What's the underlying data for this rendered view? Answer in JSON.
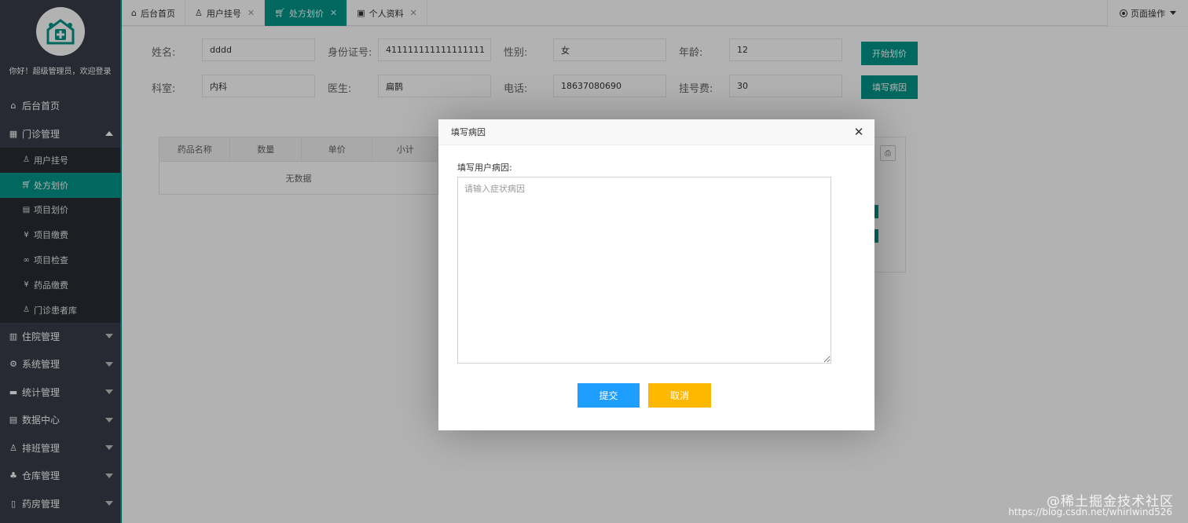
{
  "sidebar": {
    "welcome": "你好！超级管理员，欢迎登录",
    "home": "后台首页",
    "outpatient": "门诊管理",
    "sub_items": [
      {
        "label": "用户挂号",
        "icon": "user-icon"
      },
      {
        "label": "处方划价",
        "icon": "cart-icon"
      },
      {
        "label": "项目划价",
        "icon": "doc-icon"
      },
      {
        "label": "项目缴费",
        "icon": "yen-icon"
      },
      {
        "label": "项目检查",
        "icon": "link-icon"
      },
      {
        "label": "药品缴费",
        "icon": "yen-icon"
      },
      {
        "label": "门诊患者库",
        "icon": "person-icon"
      }
    ],
    "groups": [
      {
        "label": "住院管理",
        "icon": "building-icon"
      },
      {
        "label": "系统管理",
        "icon": "gear-icon"
      },
      {
        "label": "统计管理",
        "icon": "chat-icon"
      },
      {
        "label": "数据中心",
        "icon": "file-icon"
      },
      {
        "label": "排班管理",
        "icon": "users-icon"
      },
      {
        "label": "仓库管理",
        "icon": "boxes-icon"
      },
      {
        "label": "药房管理",
        "icon": "book-icon"
      }
    ]
  },
  "tabs": [
    {
      "label": "后台首页",
      "icon": "home-icon"
    },
    {
      "label": "用户挂号",
      "icon": "user-icon"
    },
    {
      "label": "处方划价",
      "icon": "cart-icon"
    },
    {
      "label": "个人资料",
      "icon": "id-card-icon"
    }
  ],
  "page_ops": "页面操作",
  "form": {
    "name_label": "姓名:",
    "name_value": "dddd",
    "id_label": "身份证号:",
    "id_value": "411111111111111111",
    "gender_label": "性别:",
    "gender_value": "女",
    "age_label": "年龄:",
    "age_value": "12",
    "dept_label": "科室:",
    "dept_value": "内科",
    "doctor_label": "医生:",
    "doctor_value": "扁鹊",
    "phone_label": "电话:",
    "phone_value": "18637080690",
    "fee_label": "挂号费:",
    "fee_value": "30",
    "start_btn": "开始划价",
    "cause_btn": "填写病因"
  },
  "table": {
    "headers": [
      "药品名称",
      "数量",
      "单价",
      "小计"
    ],
    "empty": "无数据"
  },
  "modal": {
    "title": "填写病因",
    "label": "填写用户病因:",
    "placeholder": "请输入症状病因",
    "submit": "提交",
    "cancel": "取消"
  },
  "watermark": {
    "line1": "@稀土掘金技术社区",
    "line2": "https://blog.csdn.net/whirlwind526"
  },
  "colors": {
    "primary": "#009688",
    "sidebar": "#393d49",
    "submit": "#1e9fff",
    "cancel": "#ffb800"
  }
}
